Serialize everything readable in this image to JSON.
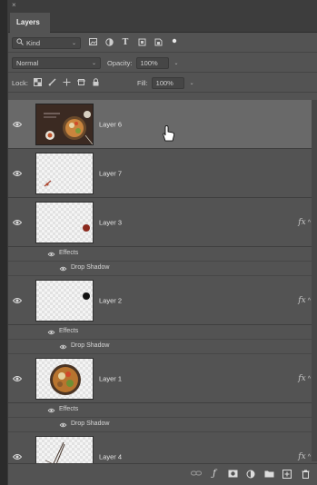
{
  "panel": {
    "close_glyph": "×",
    "tab_label": "Layers"
  },
  "filter": {
    "kind_label": "Kind"
  },
  "blend": {
    "mode_label": "Normal",
    "opacity_label": "Opacity:",
    "opacity_value": "100%"
  },
  "lock": {
    "lock_label": "Lock:",
    "fill_label": "Fill:",
    "fill_value": "100%"
  },
  "layers": [
    {
      "name": "Layer 6",
      "has_fx": false
    },
    {
      "name": "Layer 7",
      "has_fx": false
    },
    {
      "name": "Layer 3",
      "has_fx": true,
      "effects_label": "Effects",
      "effect_item": "Drop Shadow"
    },
    {
      "name": "Layer 2",
      "has_fx": true,
      "effects_label": "Effects",
      "effect_item": "Drop Shadow"
    },
    {
      "name": "Layer 1",
      "has_fx": true,
      "effects_label": "Effects",
      "effect_item": "Drop Shadow"
    },
    {
      "name": "Layer 4",
      "has_fx": true
    }
  ],
  "fx_glyph": "fx",
  "fx_caret": "^",
  "icons": {
    "filter": [
      "search-icon",
      "image-filter-icon",
      "adjustment-filter-icon",
      "type-filter-icon",
      "shape-filter-icon",
      "smart-object-filter-icon",
      "filter-toggle-icon"
    ],
    "lock": [
      "lock-transparent-icon",
      "lock-paint-icon",
      "lock-position-icon",
      "lock-artboard-icon",
      "lock-all-icon"
    ],
    "bottom": [
      "link-layers-icon",
      "add-style-icon",
      "add-mask-icon",
      "new-adjustment-icon",
      "new-group-icon",
      "new-layer-icon",
      "delete-layer-icon"
    ]
  },
  "colors": {
    "panel_bg": "#535353",
    "selected_row": "#696969",
    "header_bg": "#3d3d3d"
  }
}
